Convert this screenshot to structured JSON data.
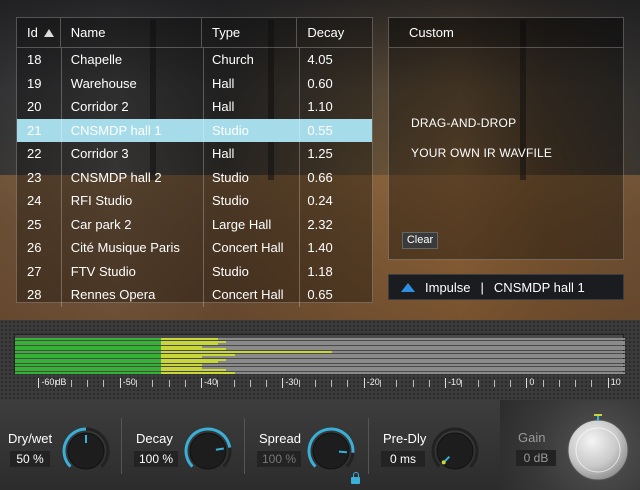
{
  "table": {
    "headers": {
      "id": "Id",
      "name": "Name",
      "type": "Type",
      "decay": "Decay"
    },
    "rows": [
      {
        "id": "18",
        "name": "Chapelle",
        "type": "Church",
        "decay": "4.05"
      },
      {
        "id": "19",
        "name": "Warehouse",
        "type": "Hall",
        "decay": "0.60"
      },
      {
        "id": "20",
        "name": "Corridor 2",
        "type": "Hall",
        "decay": "1.10"
      },
      {
        "id": "21",
        "name": "CNSMDP hall 1",
        "type": "Studio",
        "decay": "0.55"
      },
      {
        "id": "22",
        "name": "Corridor 3",
        "type": "Hall",
        "decay": "1.25"
      },
      {
        "id": "23",
        "name": "CNSMDP hall 2",
        "type": "Studio",
        "decay": "0.66"
      },
      {
        "id": "24",
        "name": "RFI Studio",
        "type": "Studio",
        "decay": "0.24"
      },
      {
        "id": "25",
        "name": "Car park 2",
        "type": "Large Hall",
        "decay": "2.32"
      },
      {
        "id": "26",
        "name": "Cité Musique Paris",
        "type": "Concert Hall",
        "decay": "1.40"
      },
      {
        "id": "27",
        "name": "FTV Studio",
        "type": "Studio",
        "decay": "1.18"
      },
      {
        "id": "28",
        "name": "Rennes Opera",
        "type": "Concert Hall",
        "decay": "0.65"
      }
    ],
    "selected_id": "21"
  },
  "custom": {
    "title": "Custom",
    "line1": "DRAG-AND-DROP",
    "line2": "YOUR OWN IR WAVFILE",
    "clear_label": "Clear"
  },
  "impulse": {
    "label": "Impulse",
    "separator": "|",
    "value": "CNSMDP hall 1"
  },
  "meter": {
    "scale_labels": [
      "-60",
      "dB",
      "-50",
      "-40",
      "-30",
      "-20",
      "-10",
      "0",
      "10"
    ],
    "levels_db": [
      -38,
      -37,
      -38,
      -40,
      -37,
      -24,
      -36,
      -40,
      -37,
      -38,
      -40,
      -40,
      -37,
      -36
    ]
  },
  "knobs": [
    {
      "label": "Dry/wet",
      "value": "50 %",
      "level": 0.5,
      "dim": false
    },
    {
      "label": "Decay",
      "value": "100 %",
      "level": 0.8,
      "dim": false
    },
    {
      "label": "Spread",
      "value": "100 %",
      "level": 0.85,
      "dim": true
    },
    {
      "label": "Pre-Dly",
      "value": "0 ms",
      "level": 0.0,
      "dim": false
    }
  ],
  "gain": {
    "label": "Gain",
    "value": "0 dB"
  },
  "colors": {
    "accent": "#3ab0d8",
    "selection": "#a6dcea",
    "meter_green": "#33b233",
    "meter_yellow": "#c8d638"
  }
}
